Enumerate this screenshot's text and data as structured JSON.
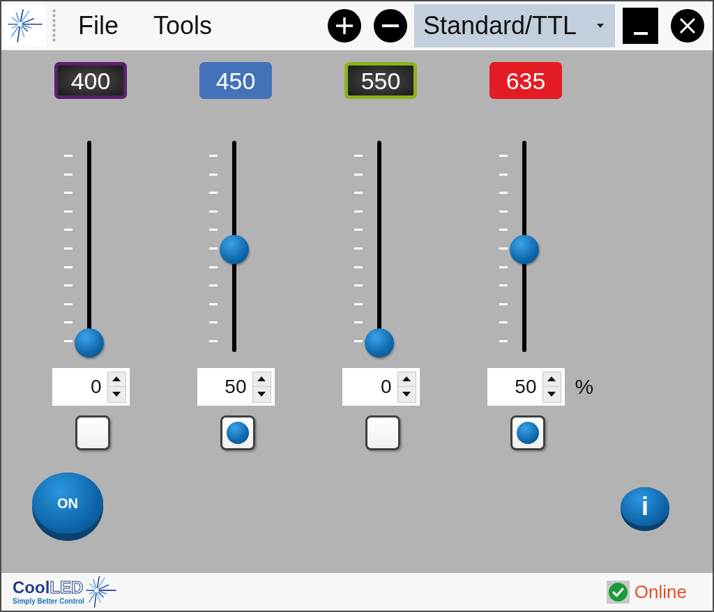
{
  "menu": [
    {
      "label": "File"
    },
    {
      "label": "Tools"
    }
  ],
  "toolbar": {
    "mode_dropdown": {
      "value": "Standard/TTL"
    }
  },
  "channels": [
    {
      "label": "400",
      "kind": "framed",
      "color": "#5b1f6e",
      "level": 0,
      "value": "0",
      "checked": false
    },
    {
      "label": "450",
      "kind": "filled",
      "color": "#4472b8",
      "level": 0.5,
      "value": "50",
      "checked": true
    },
    {
      "label": "550",
      "kind": "framed",
      "color": "#8cb41e",
      "level": 0,
      "value": "0",
      "checked": false
    },
    {
      "label": "635",
      "kind": "filled",
      "color": "#e31b23",
      "level": 0.5,
      "value": "50",
      "checked": true
    }
  ],
  "unit": "%",
  "power_button": {
    "label": "ON"
  },
  "info_button": {
    "label": "i"
  },
  "footer": {
    "logo": {
      "name_parts": [
        "Cool",
        "LED"
      ],
      "tagline": "Simply Better Control"
    },
    "status": {
      "text": "Online",
      "online": true
    }
  }
}
